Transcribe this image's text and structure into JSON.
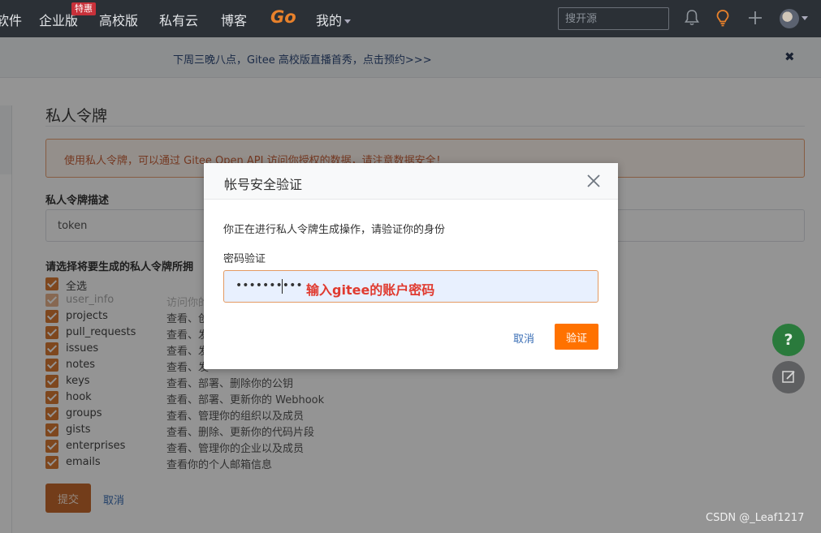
{
  "nav": {
    "items": [
      "软件",
      "企业版",
      "高校版",
      "私有云",
      "博客"
    ],
    "hot_badge": "特惠",
    "go_logo": "Go",
    "mine": "我的",
    "search_placeholder": "搜开源"
  },
  "notice": {
    "text": "下周三晚八点，Gitee 高校版直播首秀，点击预约>>>",
    "close": "✖"
  },
  "page": {
    "title": "私人令牌",
    "warning": "使用私人令牌，可以通过 Gitee Open API 访问你授权的数据，请注意数据安全！",
    "desc_label": "私人令牌描述",
    "token_value": "token",
    "scope_label": "请选择将要生成的私人令牌所拥",
    "select_all": "全选",
    "scopes": [
      {
        "name": "user_info",
        "desc": "访问你的",
        "dim": true
      },
      {
        "name": "projects",
        "desc": "查看、创",
        "dim": false
      },
      {
        "name": "pull_requests",
        "desc": "查看、发",
        "dim": false
      },
      {
        "name": "issues",
        "desc": "查看、发",
        "dim": false
      },
      {
        "name": "notes",
        "desc": "查看、发",
        "dim": false
      },
      {
        "name": "keys",
        "desc": "查看、部署、删除你的公钥",
        "dim": false
      },
      {
        "name": "hook",
        "desc": "查看、部署、更新你的 Webhook",
        "dim": false
      },
      {
        "name": "groups",
        "desc": "查看、管理你的组织以及成员",
        "dim": false
      },
      {
        "name": "gists",
        "desc": "查看、删除、更新你的代码片段",
        "dim": false
      },
      {
        "name": "enterprises",
        "desc": "查看、管理你的企业以及成员",
        "dim": false
      },
      {
        "name": "emails",
        "desc": "查看你的个人邮箱信息",
        "dim": false
      }
    ],
    "submit": "提交",
    "cancel": "取消"
  },
  "modal": {
    "title": "帐号安全验证",
    "description": "你正在进行私人令牌生成操作，请验证你的身份",
    "password_label": "密码验证",
    "password_mask": "••••••••••",
    "annotation": "输入gitee的账户密码",
    "cancel": "取消",
    "confirm": "验证"
  },
  "floating": {
    "help": "?"
  },
  "watermark": "CSDN @_Leaf1217",
  "colors": {
    "accent": "#ff7200",
    "nav_bg": "#2b3036",
    "link": "#3b6fb6",
    "annotation": "#e03a2f"
  }
}
